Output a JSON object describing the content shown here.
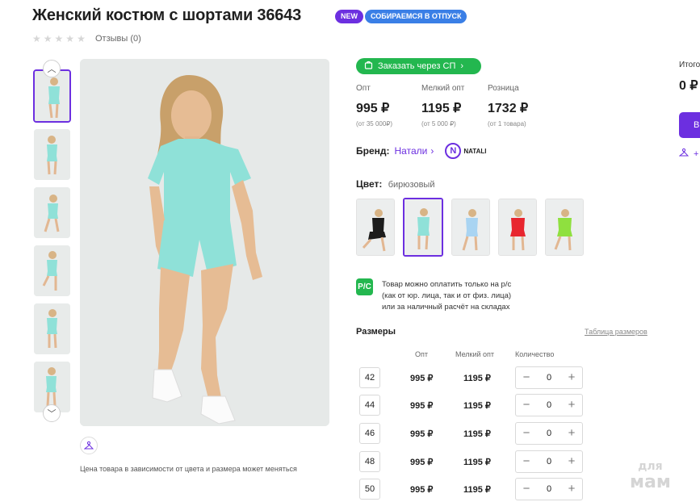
{
  "product": {
    "title": "Женский костюм с шортами 36643",
    "badges": {
      "new": "NEW",
      "vacation": "СОБИРАЕМСЯ В ОТПУСК"
    },
    "reviews": "Отзывы (0)",
    "rating": 0,
    "price_note": "Цена товара в зависимости от цвета и размера может меняться"
  },
  "sp_button": "Заказать через СП",
  "prices": [
    {
      "label": "Опт",
      "value": "995 ₽",
      "sub": "(от 35 000₽)"
    },
    {
      "label": "Мелкий опт",
      "value": "1195 ₽",
      "sub": "(от 5 000 ₽)"
    },
    {
      "label": "Розница",
      "value": "1732 ₽",
      "sub": "(от 1 товара)"
    }
  ],
  "brand": {
    "label": "Бренд:",
    "name": "Натали",
    "logo_letter": "N",
    "logo_text": "NATALI"
  },
  "color": {
    "label": "Цвет:",
    "value": "бирюзовый",
    "swatch_colors": [
      "#1c1c1c",
      "#8fe1d8",
      "#a9d4f2",
      "#e8262f",
      "#8fe03f"
    ],
    "selected_index": 1
  },
  "payment": {
    "icon": "Р/С",
    "lines": [
      "Товар можно оплатить только на р/с",
      "(как от юр. лица, так и от физ. лица)",
      "или за наличный расчёт на складах"
    ]
  },
  "sizes": {
    "title": "Размеры",
    "table_link": "Таблица размеров",
    "headers": {
      "opt": "Опт",
      "small_opt": "Мелкий опт",
      "qty": "Количество"
    },
    "rows": [
      {
        "size": "42",
        "opt": "995 ₽",
        "small_opt": "1195 ₽",
        "qty": "0"
      },
      {
        "size": "44",
        "opt": "995 ₽",
        "small_opt": "1195 ₽",
        "qty": "0"
      },
      {
        "size": "46",
        "opt": "995 ₽",
        "small_opt": "1195 ₽",
        "qty": "0"
      },
      {
        "size": "48",
        "opt": "995 ₽",
        "small_opt": "1195 ₽",
        "qty": "0"
      },
      {
        "size": "50",
        "opt": "995 ₽",
        "small_opt": "1195 ₽",
        "qty": "0"
      }
    ]
  },
  "summary": {
    "total_label": "Итого",
    "total_value": "0 ₽",
    "buy_label": "В"
  },
  "watermark": {
    "line1": "для",
    "line2": "мам"
  },
  "colors": {
    "accent": "#6c2fe0",
    "green": "#23b74f",
    "badge_blue": "#3a7fe6",
    "suit": "#8fe1d8"
  }
}
